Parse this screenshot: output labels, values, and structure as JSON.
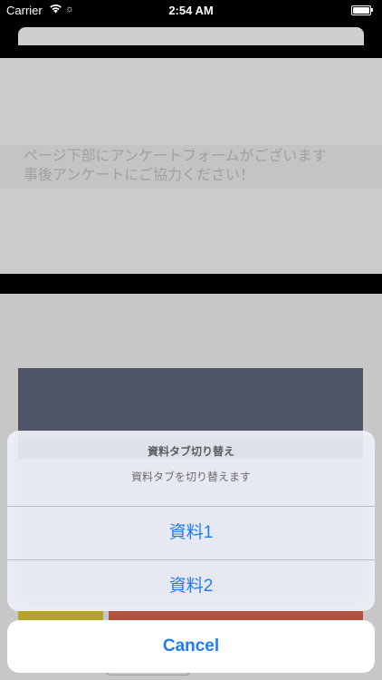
{
  "status_bar": {
    "carrier": "Carrier",
    "wifi_icon": "wifi-icon",
    "activity_icon": "activity-spinner-icon",
    "spinner_glyph": "☼",
    "time": "2:54 AM",
    "battery_icon": "battery-full-icon"
  },
  "notice": {
    "line1": "ページ下部にアンケートフォームがございます",
    "line2": "事後アンケートにご協力ください！"
  },
  "colors": {
    "accent": "#1f7cf0",
    "dark_panel": "#4f5468",
    "yellow_block": "#b6a42a",
    "red_block": "#b2523e"
  },
  "action_sheet": {
    "title": "資料タブ切り替え",
    "message": "資料タブを切り替えます",
    "options": [
      {
        "label": "資料1"
      },
      {
        "label": "資料2"
      }
    ],
    "cancel_label": "Cancel"
  }
}
